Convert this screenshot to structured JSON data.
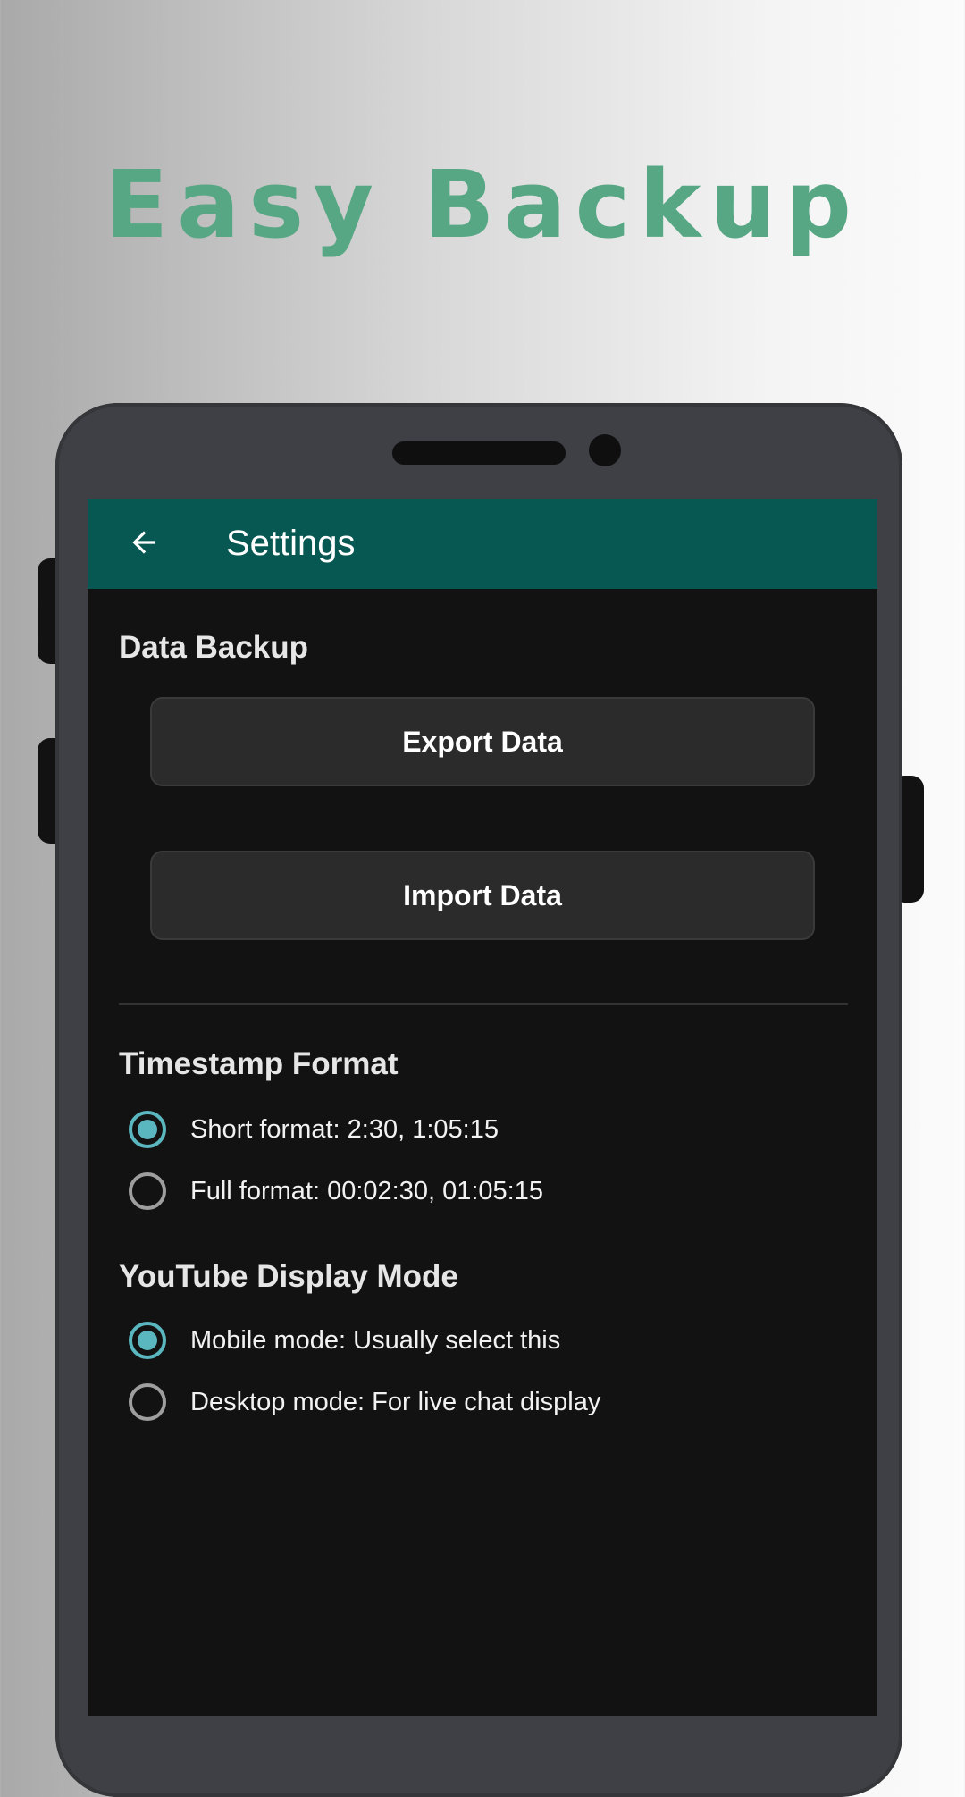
{
  "headline": "Easy Backup",
  "colors": {
    "headline": "#57a784",
    "appbar": "#075752",
    "screen_bg": "#121212",
    "button_bg": "#2b2b2b",
    "radio_accent": "#5ab7bf"
  },
  "appbar": {
    "back_icon": "arrow-left-icon",
    "title": "Settings"
  },
  "data_backup": {
    "title": "Data Backup",
    "export_label": "Export Data",
    "import_label": "Import Data"
  },
  "timestamp_format": {
    "title": "Timestamp Format",
    "options": [
      {
        "label": "Short format: 2:30, 1:05:15",
        "selected": true
      },
      {
        "label": "Full format: 00:02:30, 01:05:15",
        "selected": false
      }
    ]
  },
  "youtube_display_mode": {
    "title": "YouTube Display Mode",
    "options": [
      {
        "label": "Mobile mode: Usually select this",
        "selected": true
      },
      {
        "label": "Desktop mode: For live chat display",
        "selected": false
      }
    ]
  }
}
